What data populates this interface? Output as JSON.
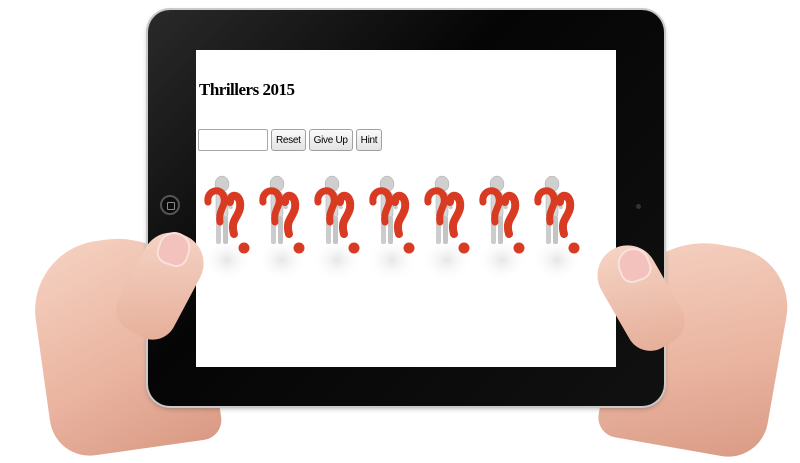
{
  "page": {
    "title": "Thrillers 2015"
  },
  "controls": {
    "guess_value": "",
    "reset_label": "Reset",
    "give_up_label": "Give Up",
    "hint_label": "Hint"
  },
  "figures": {
    "count": 7,
    "icon": "person-with-question-mark-icon",
    "question_color": "#d93a22"
  },
  "device": {
    "frame_color": "#0a0a0a"
  }
}
